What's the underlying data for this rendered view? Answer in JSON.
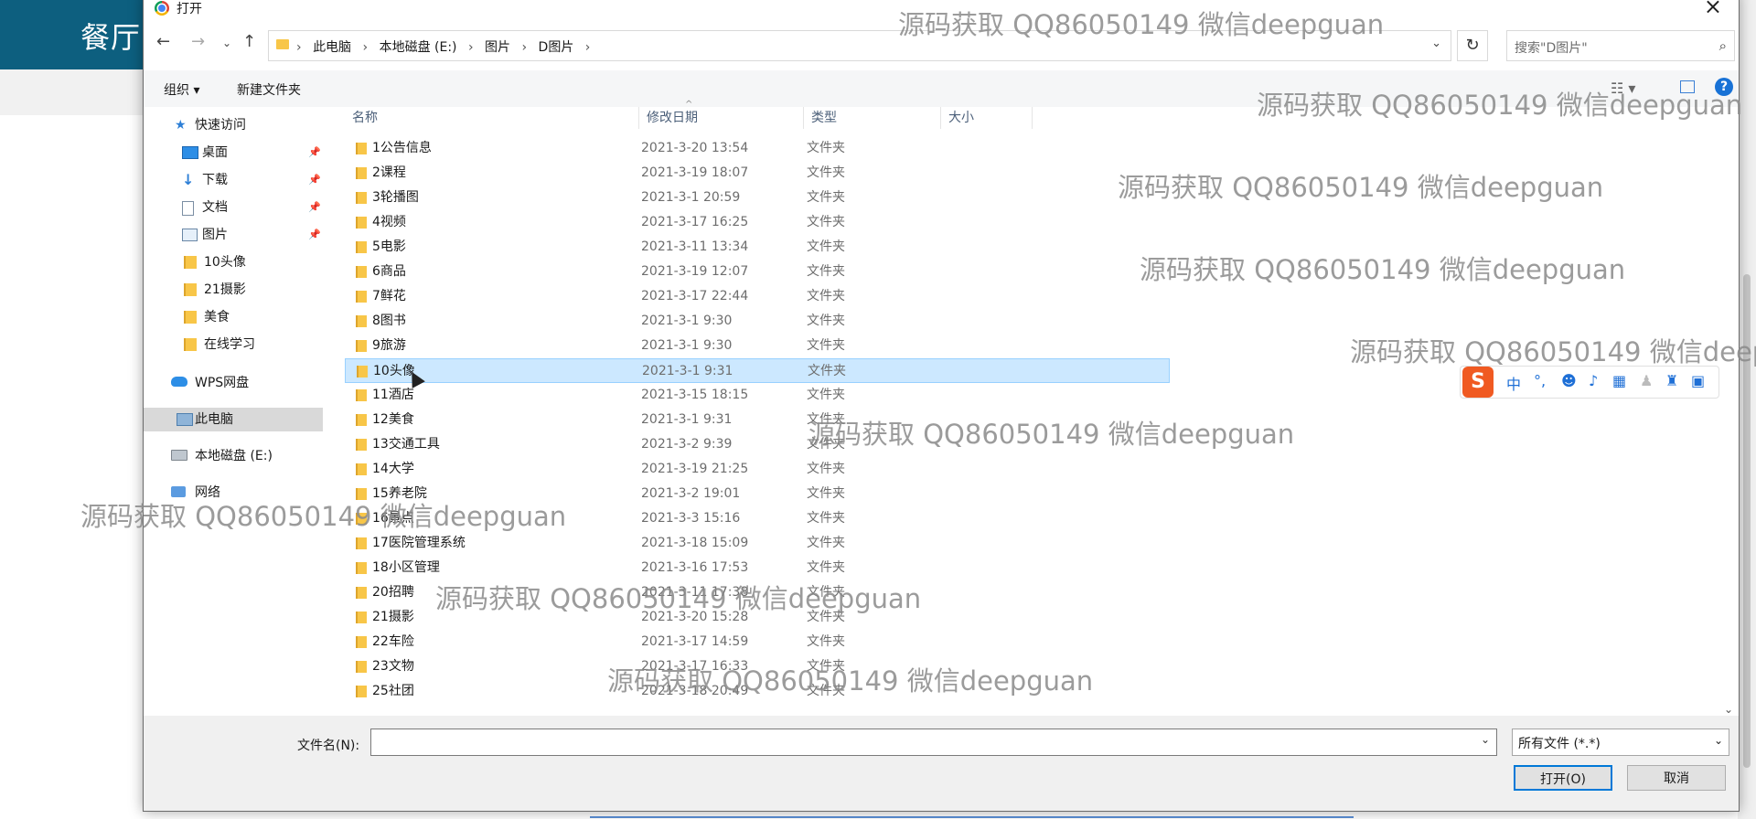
{
  "background_page": {
    "title": "餐厅"
  },
  "dialog": {
    "title": "打开",
    "breadcrumbs": [
      "此电脑",
      "本地磁盘 (E:)",
      "图片",
      "D图片"
    ],
    "search_placeholder": "搜索\"D图片\"",
    "toolbar": {
      "organize": "组织 ▾",
      "new_folder": "新建文件夹"
    },
    "nav_pane": [
      {
        "label": "快速访问",
        "icon": "star-icon"
      },
      {
        "label": "桌面",
        "icon": "desktop-icon",
        "pinned": true
      },
      {
        "label": "下载",
        "icon": "download-icon",
        "pinned": true
      },
      {
        "label": "文档",
        "icon": "document-icon",
        "pinned": true
      },
      {
        "label": "图片",
        "icon": "pictures-icon",
        "pinned": true
      },
      {
        "label": "10头像",
        "icon": "folder-icon"
      },
      {
        "label": "21摄影",
        "icon": "folder-icon"
      },
      {
        "label": "美食",
        "icon": "folder-icon"
      },
      {
        "label": "在线学习",
        "icon": "folder-icon"
      },
      {
        "label": "WPS网盘",
        "icon": "cloud-icon"
      },
      {
        "label": "此电脑",
        "icon": "computer-icon",
        "selected": true
      },
      {
        "label": "本地磁盘 (E:)",
        "icon": "disk-icon"
      },
      {
        "label": "网络",
        "icon": "network-icon"
      }
    ],
    "columns": [
      "名称",
      "修改日期",
      "类型",
      "大小"
    ],
    "files": [
      {
        "name": "1公告信息",
        "date": "2021-3-20 13:54",
        "type": "文件夹"
      },
      {
        "name": "2课程",
        "date": "2021-3-19 18:07",
        "type": "文件夹"
      },
      {
        "name": "3轮播图",
        "date": "2021-3-1 20:59",
        "type": "文件夹"
      },
      {
        "name": "4视频",
        "date": "2021-3-17 16:25",
        "type": "文件夹"
      },
      {
        "name": "5电影",
        "date": "2021-3-11 13:34",
        "type": "文件夹"
      },
      {
        "name": "6商品",
        "date": "2021-3-19 12:07",
        "type": "文件夹"
      },
      {
        "name": "7鲜花",
        "date": "2021-3-17 22:44",
        "type": "文件夹"
      },
      {
        "name": "8图书",
        "date": "2021-3-1 9:30",
        "type": "文件夹"
      },
      {
        "name": "9旅游",
        "date": "2021-3-1 9:30",
        "type": "文件夹"
      },
      {
        "name": "10头像",
        "date": "2021-3-1 9:31",
        "type": "文件夹",
        "selected": true
      },
      {
        "name": "11酒店",
        "date": "2021-3-15 18:15",
        "type": "文件夹"
      },
      {
        "name": "12美食",
        "date": "2021-3-1 9:31",
        "type": "文件夹"
      },
      {
        "name": "13交通工具",
        "date": "2021-3-2 9:39",
        "type": "文件夹"
      },
      {
        "name": "14大学",
        "date": "2021-3-19 21:25",
        "type": "文件夹"
      },
      {
        "name": "15养老院",
        "date": "2021-3-2 19:01",
        "type": "文件夹"
      },
      {
        "name": "16景点",
        "date": "2021-3-3 15:16",
        "type": "文件夹"
      },
      {
        "name": "17医院管理系统",
        "date": "2021-3-18 15:09",
        "type": "文件夹"
      },
      {
        "name": "18小区管理",
        "date": "2021-3-16 17:53",
        "type": "文件夹"
      },
      {
        "name": "20招聘",
        "date": "2021-3-11 17:38",
        "type": "文件夹"
      },
      {
        "name": "21摄影",
        "date": "2021-3-20 15:28",
        "type": "文件夹"
      },
      {
        "name": "22车险",
        "date": "2021-3-17 14:59",
        "type": "文件夹"
      },
      {
        "name": "23文物",
        "date": "2021-3-17 16:33",
        "type": "文件夹"
      },
      {
        "name": "25社团",
        "date": "2021-3-18 20:49",
        "type": "文件夹"
      }
    ],
    "filename_label": "文件名(N):",
    "filename_value": "",
    "filter": "所有文件 (*.*)",
    "open_button": "打开(O)",
    "cancel_button": "取消"
  },
  "ime_toolbar": {
    "logo": "S",
    "mode": "中"
  },
  "watermark": "源码获取 QQ86050149 微信deepguan"
}
